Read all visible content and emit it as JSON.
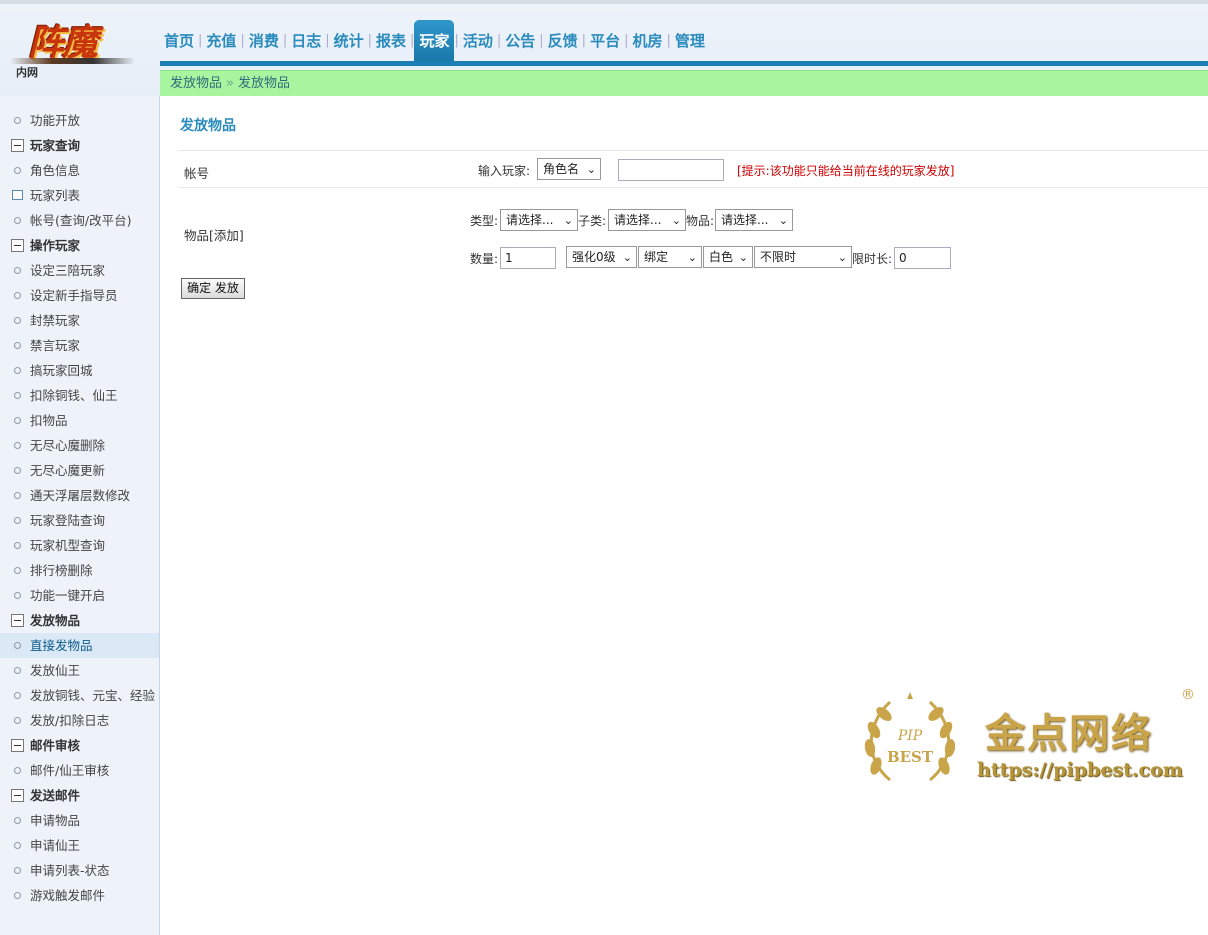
{
  "header": {
    "logo_text": "阵魔",
    "logo_sub": "内网",
    "nav": [
      "首页",
      "充值",
      "消费",
      "日志",
      "统计",
      "报表",
      "玩家",
      "活动",
      "公告",
      "反馈",
      "平台",
      "机房",
      "管理"
    ],
    "active_nav": "玩家"
  },
  "breadcrumb": [
    "发放物品",
    "发放物品"
  ],
  "breadcrumb_sep": "»",
  "sidebar": {
    "items": [
      {
        "type": "item",
        "label": "功能开放"
      },
      {
        "type": "group",
        "label": "玩家查询"
      },
      {
        "type": "item",
        "label": "角色信息"
      },
      {
        "type": "item",
        "label": "玩家列表"
      },
      {
        "type": "item",
        "label": "帐号(查询/改平台)"
      },
      {
        "type": "group",
        "label": "操作玩家"
      },
      {
        "type": "item",
        "label": "设定三陪玩家"
      },
      {
        "type": "item",
        "label": "设定新手指导员"
      },
      {
        "type": "item",
        "label": "封禁玩家"
      },
      {
        "type": "item",
        "label": "禁言玩家"
      },
      {
        "type": "item",
        "label": "搞玩家回城"
      },
      {
        "type": "item",
        "label": "扣除铜钱、仙王"
      },
      {
        "type": "item",
        "label": "扣物品"
      },
      {
        "type": "item",
        "label": "无尽心魔删除"
      },
      {
        "type": "item",
        "label": "无尽心魔更新"
      },
      {
        "type": "item",
        "label": "通天浮屠层数修改"
      },
      {
        "type": "item",
        "label": "玩家登陆查询"
      },
      {
        "type": "item",
        "label": "玩家机型查询"
      },
      {
        "type": "item",
        "label": "排行榜删除"
      },
      {
        "type": "item",
        "label": "功能一键开启"
      },
      {
        "type": "group",
        "label": "发放物品"
      },
      {
        "type": "item",
        "label": "直接发物品"
      },
      {
        "type": "item",
        "label": "发放仙王"
      },
      {
        "type": "item",
        "label": "发放铜钱、元宝、经验"
      },
      {
        "type": "item",
        "label": "发放/扣除日志"
      },
      {
        "type": "group",
        "label": "邮件审核"
      },
      {
        "type": "item",
        "label": "邮件/仙王审核"
      },
      {
        "type": "group",
        "label": "发送邮件"
      },
      {
        "type": "item",
        "label": "申请物品"
      },
      {
        "type": "item",
        "label": "申请仙王"
      },
      {
        "type": "item",
        "label": "申请列表-状态"
      },
      {
        "type": "item",
        "label": "游戏触发邮件"
      }
    ],
    "active_label": "直接发物品",
    "hover_label": "玩家列表"
  },
  "main": {
    "title": "发放物品",
    "account": {
      "label": "帐号",
      "input_label": "输入玩家:",
      "select_value": "角色名",
      "player_value": "",
      "hint": "[提示:该功能只能给当前在线的玩家发放]"
    },
    "item": {
      "label": "物品[添加]",
      "type_label": "类型:",
      "type_value": "请选择...",
      "subtype_label": "子类:",
      "subtype_value": "请选择...",
      "item_label": "物品:",
      "item_value": "请选择...",
      "qty_label": "数量:",
      "qty_value": "1",
      "enhance_value": "强化0级",
      "bind_value": "绑定",
      "color_value": "白色",
      "limit_value": "不限时",
      "duration_label": "限时长:",
      "duration_value": "0"
    },
    "submit_label": "确定 发放"
  },
  "watermark": {
    "badge_top": "PIP",
    "badge_bottom": "BEST",
    "name": "金点网络",
    "url": "https://pipbest.com",
    "reg": "®"
  }
}
